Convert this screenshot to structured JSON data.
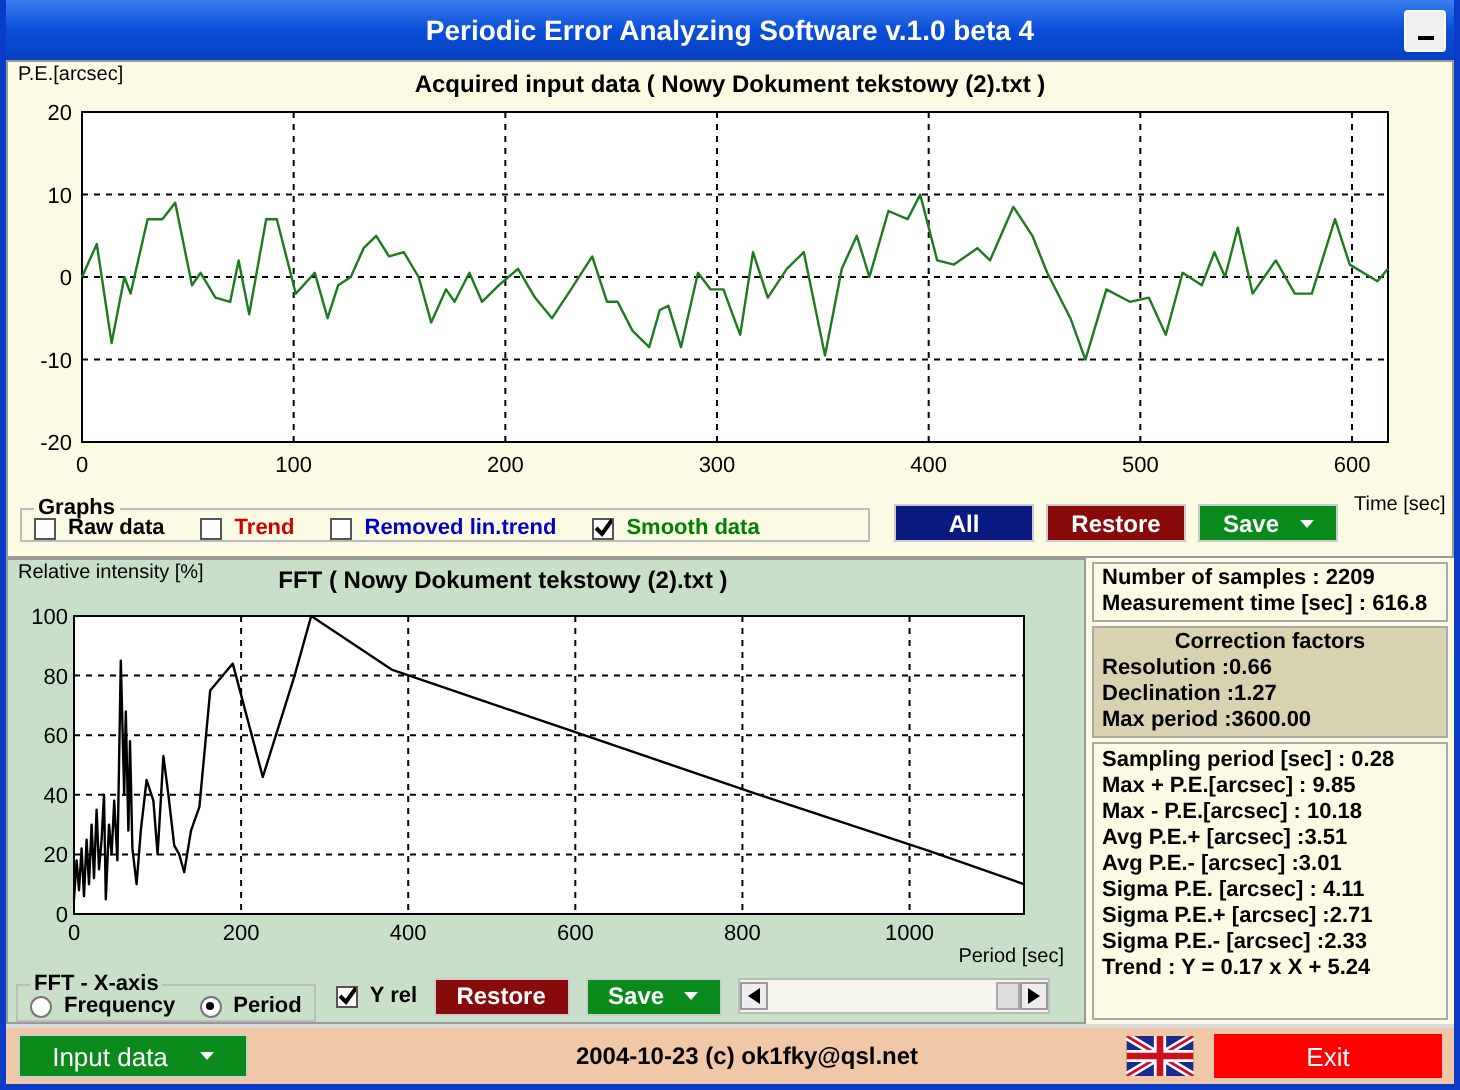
{
  "window": {
    "title": "Periodic Error Analyzing Software v.1.0 beta 4"
  },
  "input_panel": {
    "chart_data": {
      "type": "line",
      "title": "Acquired input data ( Nowy Dokument tekstowy (2).txt )",
      "xlabel": "Time [sec]",
      "ylabel": "P.E.[arcsec]",
      "x": [
        0,
        7,
        14,
        20,
        23,
        31,
        38,
        44,
        52,
        56,
        63,
        70,
        74,
        79,
        87,
        92,
        101,
        110,
        116,
        121,
        127,
        133,
        139,
        145,
        152,
        159,
        165,
        172,
        176,
        183,
        189,
        197,
        206,
        214,
        222,
        231,
        241,
        248,
        253,
        260,
        268,
        273,
        277,
        283,
        291,
        297,
        303,
        311,
        317,
        324,
        333,
        341,
        351,
        359,
        366,
        372,
        381,
        390,
        396,
        404,
        412,
        423,
        429,
        440,
        449,
        456,
        467,
        474,
        484,
        495,
        504,
        512,
        520,
        529,
        535,
        540,
        546,
        553,
        564,
        573,
        581,
        592,
        599,
        612,
        617
      ],
      "grid": true,
      "series": [
        {
          "color": "#1e7a1e",
          "values": [
            0,
            4,
            -8,
            0,
            -2,
            7,
            7,
            9,
            -1,
            0.5,
            -2.5,
            -3,
            2,
            -4.5,
            7,
            7,
            -2,
            0.5,
            -5,
            -1,
            0,
            3.5,
            5,
            2.5,
            3,
            0,
            -5.5,
            -1.5,
            -3,
            0.5,
            -3,
            -1,
            1,
            -2.5,
            -5,
            -1.5,
            2.5,
            -3,
            -3,
            -6.5,
            -8.5,
            -4,
            -3.5,
            -8.5,
            0.5,
            -1.5,
            -1.5,
            -7,
            3,
            -2.5,
            1,
            3,
            -9.5,
            1,
            5,
            0,
            8,
            7,
            10,
            2,
            1.5,
            3.5,
            2,
            8.5,
            5,
            0.5,
            -5,
            -10,
            -1.5,
            -3,
            -2.5,
            -7,
            0.5,
            -1,
            3,
            0,
            6,
            -2,
            2,
            -2,
            -2,
            7,
            1.5,
            -0.5,
            1
          ]
        }
      ],
      "xlim": [
        0,
        617
      ],
      "ylim": [
        -20,
        20
      ],
      "xticks": [
        0,
        100,
        200,
        300,
        400,
        500,
        600
      ],
      "yticks": [
        -20,
        -10,
        0,
        10,
        20
      ]
    },
    "graphs": {
      "label": "Graphs",
      "options": [
        {
          "label": "Raw data",
          "checked": false,
          "color": "#000000"
        },
        {
          "label": "Trend",
          "checked": false,
          "color": "#d00000"
        },
        {
          "label": "Removed lin.trend",
          "checked": false,
          "color": "#0000c8"
        },
        {
          "label": "Smooth data",
          "checked": true,
          "color": "#008000"
        }
      ]
    },
    "buttons": [
      {
        "label": "All",
        "kind": "all"
      },
      {
        "label": "Restore",
        "kind": "restore"
      },
      {
        "label": "Save",
        "kind": "save"
      }
    ]
  },
  "fft_panel": {
    "chart_data": {
      "type": "line",
      "title": "FFT ( Nowy Dokument tekstowy (2).txt )",
      "xlabel": "Period [sec]",
      "ylabel": "Relative intensity [%]",
      "x": [
        0,
        3,
        6,
        9,
        12,
        15,
        18,
        21,
        24,
        27,
        30,
        33,
        36,
        38,
        42,
        45,
        48,
        52,
        56,
        60,
        62,
        65,
        67,
        70,
        75,
        80,
        87,
        95,
        100,
        107,
        113,
        120,
        126,
        132,
        140,
        150,
        163,
        190,
        226,
        264,
        284,
        380,
        600,
        820,
        1025,
        1137
      ],
      "grid": true,
      "series": [
        {
          "color": "#000000",
          "values": [
            5,
            18,
            8,
            22,
            6,
            25,
            10,
            30,
            12,
            35,
            15,
            25,
            40,
            5,
            30,
            20,
            38,
            18,
            85,
            40,
            68,
            28,
            58,
            22,
            10,
            28,
            45,
            38,
            20,
            53,
            40,
            23,
            20,
            14,
            28,
            36,
            75,
            84,
            46,
            80,
            100,
            82,
            61,
            40,
            21,
            10
          ]
        }
      ],
      "xlim": [
        0,
        1137
      ],
      "ylim": [
        0,
        100
      ],
      "xticks": [
        0,
        200,
        400,
        600,
        800,
        1000
      ],
      "yticks": [
        0,
        20,
        40,
        60,
        80,
        100
      ]
    },
    "x_axis": {
      "label": "FFT - X-axis",
      "options": [
        {
          "label": "Frequency",
          "selected": false
        },
        {
          "label": "Period",
          "selected": true
        }
      ]
    },
    "y_rel": {
      "label": "Y rel",
      "checked": true
    },
    "buttons": [
      {
        "label": "Restore",
        "kind": "restore"
      },
      {
        "label": "Save",
        "kind": "save"
      }
    ]
  },
  "stats": {
    "summary": [
      "Number of samples : 2209",
      "Measurement time [sec] : 616.8"
    ],
    "correction": {
      "title": "Correction factors",
      "lines": [
        "Resolution :0.66",
        "Declination :1.27",
        "Max period :3600.00"
      ]
    },
    "results": [
      "Sampling period [sec] : 0.28",
      "Max + P.E.[arcsec] : 9.85",
      "Max - P.E.[arcsec] : 10.18",
      "Avg P.E.+ [arcsec] :3.51",
      "Avg P.E.- [arcsec] :3.01",
      "Sigma P.E. [arcsec] : 4.11",
      "Sigma P.E.+ [arcsec] :2.71",
      "Sigma P.E.- [arcsec] :2.33",
      "Trend : Y = 0.17 x X + 5.24"
    ]
  },
  "status_bar": {
    "input_button": "Input data",
    "copyright": "2004-10-23 (c) ok1fky@qsl.net",
    "exit_button": "Exit"
  }
}
